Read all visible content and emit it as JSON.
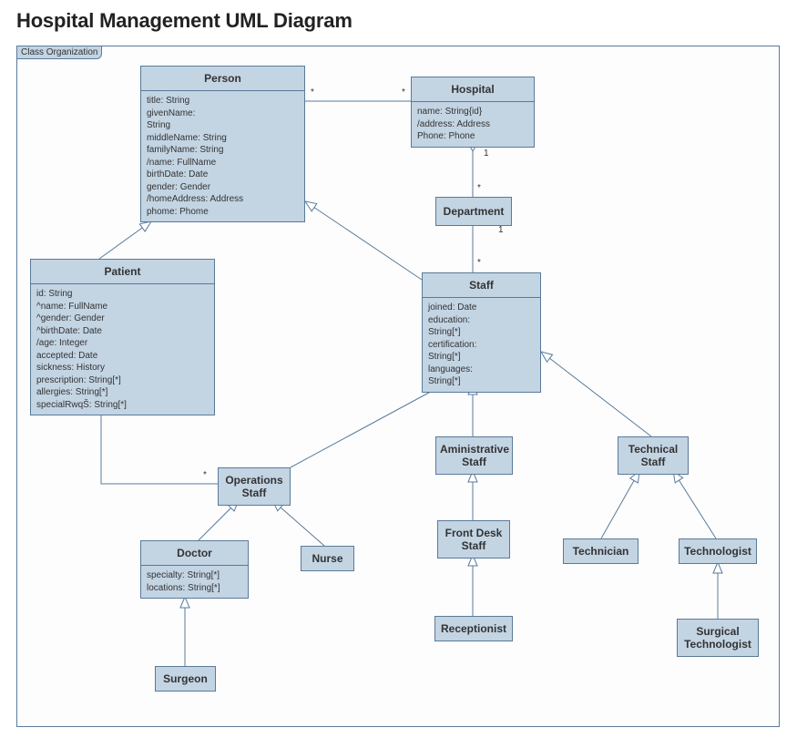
{
  "page_title": "Hospital Management UML Diagram",
  "frame_label": "Class Organization",
  "classes": {
    "person": {
      "name": "Person",
      "attrs": "title: String\ngivenName:\nString\nmiddleName: String\nfamilyName: String\n/name: FullName\nbirthDate: Date\ngender: Gender\n/homeAddress: Address\nphome: Phome"
    },
    "hospital": {
      "name": "Hospital",
      "attrs": "name: String{id}\n/address: Address\nPhone: Phone"
    },
    "department": {
      "name": "Department"
    },
    "patient": {
      "name": "Patient",
      "attrs": "id: String\n^name: FullName\n^gender: Gender\n^birthDate: Date\n/age: Integer\naccepted: Date\nsickness: History\nprescription: String[*]\nallergies: String[*]\nspecialRwqŠ: String[*]"
    },
    "staff": {
      "name": "Staff",
      "attrs": "joined: Date\neducation:\nString[*]\ncertification:\nString[*]\nlanguages:\nString[*]"
    },
    "administrative_staff": {
      "name": "Aministrative\nStaff"
    },
    "technical_staff": {
      "name": "Technical\nStaff"
    },
    "operations_staff": {
      "name": "Operations\nStaff"
    },
    "front_desk_staff": {
      "name": "Front Desk\nStaff"
    },
    "technician": {
      "name": "Technician"
    },
    "technologist": {
      "name": "Technologist"
    },
    "doctor": {
      "name": "Doctor",
      "attrs": "specialty: String[*]\nlocations: String[*]"
    },
    "nurse": {
      "name": "Nurse"
    },
    "receptionist": {
      "name": "Receptionist"
    },
    "surgical_technologist": {
      "name": "Surgical\nTechnologist"
    },
    "surgeon": {
      "name": "Surgeon"
    }
  },
  "multiplicities": {
    "m1": "*",
    "m2": "*",
    "m3": "1",
    "m4": "*",
    "m5": "1",
    "m6": "*",
    "m7": "*",
    "m8": "*"
  }
}
